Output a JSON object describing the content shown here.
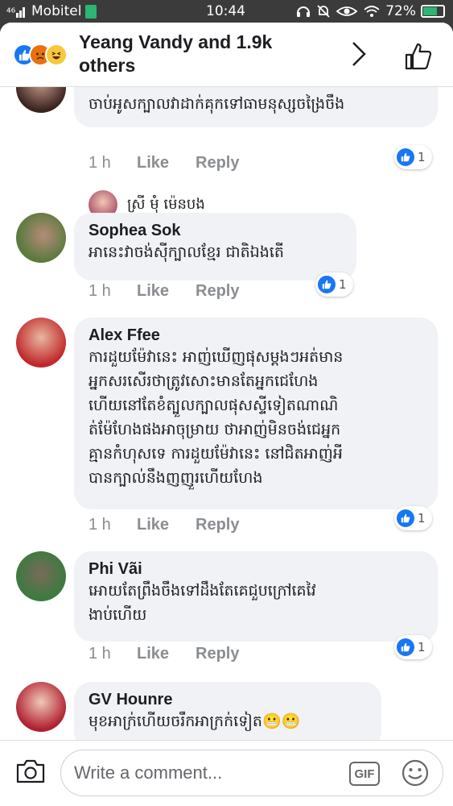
{
  "status_bar": {
    "carrier": "Mobitel",
    "time": "10:44",
    "battery": "72%",
    "battery_level": 0.72
  },
  "header": {
    "title": "Yeang Vandy and 1.9k others",
    "reactions": [
      "like",
      "angry",
      "haha"
    ]
  },
  "comments": [
    {
      "name": "",
      "text": "ចាប់អូសក្បាលវាដាក់គុកទៅធាមនុស្សចង្រៃចឹង",
      "time": "1 h",
      "like": "Like",
      "reply": "Reply",
      "reaction_count": "1"
    },
    {
      "name": "Sophea Sok",
      "text": "អានេះវាចង់ស៊ីក្បាលខ្មែរ ជាតិឯងតើ",
      "time": "1 h",
      "like": "Like",
      "reply": "Reply",
      "reaction_count": "1"
    },
    {
      "name": "Alex Ffee",
      "text": "ការដួយម៉ែវានេះ អាញ់ឃើញផុសម្ដងៗអត់មាន\nអ្នកសរសើរថាត្រូវសោះមានតែអ្នកជេហែង\nហើយនៅតែខំត្បួលក្បាលផុសស្ទីទៀតណាណិ\nត់ម៉ែហែងផងអាចុម្រាយ ថាអាញ់មិនចង់ជេអ្នក\nគ្មានកំហុសទេ ការដួយម៉ែវានេះ នៅជិតអាញ់អី\nបានក្បាល់នឹងញញួរហើយហែង",
      "time": "1 h",
      "like": "Like",
      "reply": "Reply",
      "reaction_count": "1"
    },
    {
      "name": "Phi Vãi",
      "text": "អោយតែព្រឹងចឹងទៅដឹងតែគេជួបក្រៅគេវៃ\nងាប់ហើយ",
      "time": "1 h",
      "like": "Like",
      "reply": "Reply",
      "reaction_count": "1"
    },
    {
      "name": "GV Hounre",
      "text": "មុខអាក្រ់ហើយចរឹកអាក្រក់ទៀត😬😬",
      "time": "",
      "like": "",
      "reply": "",
      "reaction_count": ""
    }
  ],
  "reply_preview": {
    "name": "ស្រី មុំ ម៉េនបង"
  },
  "composer": {
    "placeholder": "Write a comment...",
    "gif_label": "GIF"
  },
  "colors": {
    "accent": "#1877f2",
    "bubble": "#f0f2f5",
    "muted": "#8a8d91"
  }
}
